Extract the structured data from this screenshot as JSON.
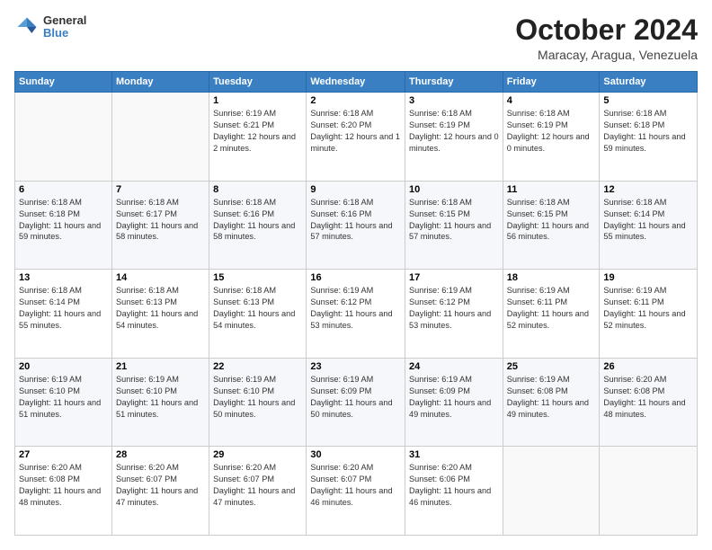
{
  "header": {
    "logo": {
      "general": "General",
      "blue": "Blue"
    },
    "title": "October 2024",
    "location": "Maracay, Aragua, Venezuela"
  },
  "days_header": [
    "Sunday",
    "Monday",
    "Tuesday",
    "Wednesday",
    "Thursday",
    "Friday",
    "Saturday"
  ],
  "weeks": [
    [
      {
        "day": "",
        "empty": true
      },
      {
        "day": "",
        "empty": true
      },
      {
        "day": "1",
        "sunrise": "Sunrise: 6:19 AM",
        "sunset": "Sunset: 6:21 PM",
        "daylight": "Daylight: 12 hours and 2 minutes."
      },
      {
        "day": "2",
        "sunrise": "Sunrise: 6:18 AM",
        "sunset": "Sunset: 6:20 PM",
        "daylight": "Daylight: 12 hours and 1 minute."
      },
      {
        "day": "3",
        "sunrise": "Sunrise: 6:18 AM",
        "sunset": "Sunset: 6:19 PM",
        "daylight": "Daylight: 12 hours and 0 minutes."
      },
      {
        "day": "4",
        "sunrise": "Sunrise: 6:18 AM",
        "sunset": "Sunset: 6:19 PM",
        "daylight": "Daylight: 12 hours and 0 minutes."
      },
      {
        "day": "5",
        "sunrise": "Sunrise: 6:18 AM",
        "sunset": "Sunset: 6:18 PM",
        "daylight": "Daylight: 11 hours and 59 minutes."
      }
    ],
    [
      {
        "day": "6",
        "sunrise": "Sunrise: 6:18 AM",
        "sunset": "Sunset: 6:18 PM",
        "daylight": "Daylight: 11 hours and 59 minutes."
      },
      {
        "day": "7",
        "sunrise": "Sunrise: 6:18 AM",
        "sunset": "Sunset: 6:17 PM",
        "daylight": "Daylight: 11 hours and 58 minutes."
      },
      {
        "day": "8",
        "sunrise": "Sunrise: 6:18 AM",
        "sunset": "Sunset: 6:16 PM",
        "daylight": "Daylight: 11 hours and 58 minutes."
      },
      {
        "day": "9",
        "sunrise": "Sunrise: 6:18 AM",
        "sunset": "Sunset: 6:16 PM",
        "daylight": "Daylight: 11 hours and 57 minutes."
      },
      {
        "day": "10",
        "sunrise": "Sunrise: 6:18 AM",
        "sunset": "Sunset: 6:15 PM",
        "daylight": "Daylight: 11 hours and 57 minutes."
      },
      {
        "day": "11",
        "sunrise": "Sunrise: 6:18 AM",
        "sunset": "Sunset: 6:15 PM",
        "daylight": "Daylight: 11 hours and 56 minutes."
      },
      {
        "day": "12",
        "sunrise": "Sunrise: 6:18 AM",
        "sunset": "Sunset: 6:14 PM",
        "daylight": "Daylight: 11 hours and 55 minutes."
      }
    ],
    [
      {
        "day": "13",
        "sunrise": "Sunrise: 6:18 AM",
        "sunset": "Sunset: 6:14 PM",
        "daylight": "Daylight: 11 hours and 55 minutes."
      },
      {
        "day": "14",
        "sunrise": "Sunrise: 6:18 AM",
        "sunset": "Sunset: 6:13 PM",
        "daylight": "Daylight: 11 hours and 54 minutes."
      },
      {
        "day": "15",
        "sunrise": "Sunrise: 6:18 AM",
        "sunset": "Sunset: 6:13 PM",
        "daylight": "Daylight: 11 hours and 54 minutes."
      },
      {
        "day": "16",
        "sunrise": "Sunrise: 6:19 AM",
        "sunset": "Sunset: 6:12 PM",
        "daylight": "Daylight: 11 hours and 53 minutes."
      },
      {
        "day": "17",
        "sunrise": "Sunrise: 6:19 AM",
        "sunset": "Sunset: 6:12 PM",
        "daylight": "Daylight: 11 hours and 53 minutes."
      },
      {
        "day": "18",
        "sunrise": "Sunrise: 6:19 AM",
        "sunset": "Sunset: 6:11 PM",
        "daylight": "Daylight: 11 hours and 52 minutes."
      },
      {
        "day": "19",
        "sunrise": "Sunrise: 6:19 AM",
        "sunset": "Sunset: 6:11 PM",
        "daylight": "Daylight: 11 hours and 52 minutes."
      }
    ],
    [
      {
        "day": "20",
        "sunrise": "Sunrise: 6:19 AM",
        "sunset": "Sunset: 6:10 PM",
        "daylight": "Daylight: 11 hours and 51 minutes."
      },
      {
        "day": "21",
        "sunrise": "Sunrise: 6:19 AM",
        "sunset": "Sunset: 6:10 PM",
        "daylight": "Daylight: 11 hours and 51 minutes."
      },
      {
        "day": "22",
        "sunrise": "Sunrise: 6:19 AM",
        "sunset": "Sunset: 6:10 PM",
        "daylight": "Daylight: 11 hours and 50 minutes."
      },
      {
        "day": "23",
        "sunrise": "Sunrise: 6:19 AM",
        "sunset": "Sunset: 6:09 PM",
        "daylight": "Daylight: 11 hours and 50 minutes."
      },
      {
        "day": "24",
        "sunrise": "Sunrise: 6:19 AM",
        "sunset": "Sunset: 6:09 PM",
        "daylight": "Daylight: 11 hours and 49 minutes."
      },
      {
        "day": "25",
        "sunrise": "Sunrise: 6:19 AM",
        "sunset": "Sunset: 6:08 PM",
        "daylight": "Daylight: 11 hours and 49 minutes."
      },
      {
        "day": "26",
        "sunrise": "Sunrise: 6:20 AM",
        "sunset": "Sunset: 6:08 PM",
        "daylight": "Daylight: 11 hours and 48 minutes."
      }
    ],
    [
      {
        "day": "27",
        "sunrise": "Sunrise: 6:20 AM",
        "sunset": "Sunset: 6:08 PM",
        "daylight": "Daylight: 11 hours and 48 minutes."
      },
      {
        "day": "28",
        "sunrise": "Sunrise: 6:20 AM",
        "sunset": "Sunset: 6:07 PM",
        "daylight": "Daylight: 11 hours and 47 minutes."
      },
      {
        "day": "29",
        "sunrise": "Sunrise: 6:20 AM",
        "sunset": "Sunset: 6:07 PM",
        "daylight": "Daylight: 11 hours and 47 minutes."
      },
      {
        "day": "30",
        "sunrise": "Sunrise: 6:20 AM",
        "sunset": "Sunset: 6:07 PM",
        "daylight": "Daylight: 11 hours and 46 minutes."
      },
      {
        "day": "31",
        "sunrise": "Sunrise: 6:20 AM",
        "sunset": "Sunset: 6:06 PM",
        "daylight": "Daylight: 11 hours and 46 minutes."
      },
      {
        "day": "",
        "empty": true
      },
      {
        "day": "",
        "empty": true
      }
    ]
  ]
}
